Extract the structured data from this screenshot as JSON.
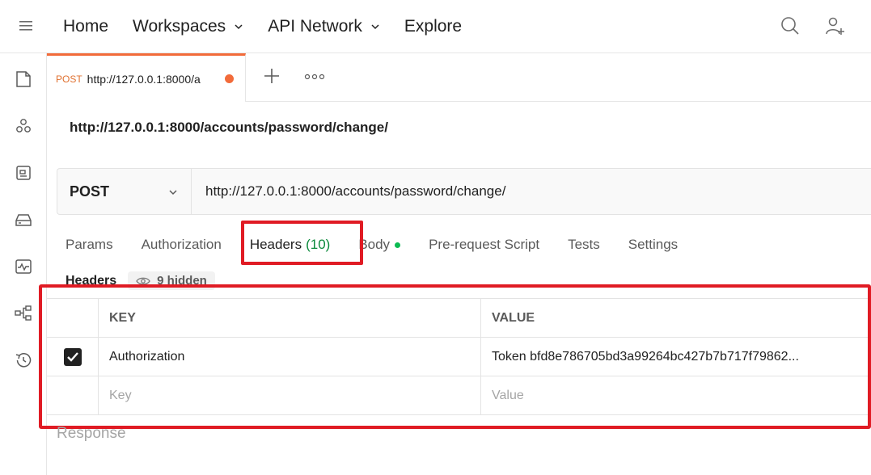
{
  "nav": {
    "items": [
      {
        "label": "Home",
        "has_dropdown": false
      },
      {
        "label": "Workspaces",
        "has_dropdown": true
      },
      {
        "label": "API Network",
        "has_dropdown": true
      },
      {
        "label": "Explore",
        "has_dropdown": false
      }
    ],
    "icons_right": [
      "search-icon",
      "add-user-icon"
    ]
  },
  "sidebar": {
    "icons": [
      "collections-icon",
      "apis-icon",
      "environments-icon",
      "mock-servers-icon",
      "monitors-icon",
      "flows-icon",
      "history-icon"
    ]
  },
  "request_tab": {
    "method": "POST",
    "url": "http://127.0.0.1:8000/a",
    "unsaved": true
  },
  "request": {
    "title": "http://127.0.0.1:8000/accounts/password/change/",
    "method": "POST",
    "url": "http://127.0.0.1:8000/accounts/password/change/"
  },
  "subtabs": {
    "params": "Params",
    "authorization": "Authorization",
    "headers": "Headers",
    "headers_count": "(10)",
    "body": "Body",
    "prerequest": "Pre-request Script",
    "tests": "Tests",
    "settings": "Settings"
  },
  "headers_section": {
    "label": "Headers",
    "hidden": "9 hidden"
  },
  "table": {
    "col_key": "KEY",
    "col_value": "VALUE",
    "rows": [
      {
        "checked": true,
        "key": "Authorization",
        "value": "Token bfd8e786705bd3a99264bc427b7b717f79862..."
      }
    ],
    "placeholder_key": "Key",
    "placeholder_value": "Value"
  },
  "response_label": "Response",
  "colors": {
    "accent": "#f26b3a",
    "highlight": "#e01b24",
    "count_green": "#0c8a3c",
    "body_dot": "#0cbb52"
  }
}
